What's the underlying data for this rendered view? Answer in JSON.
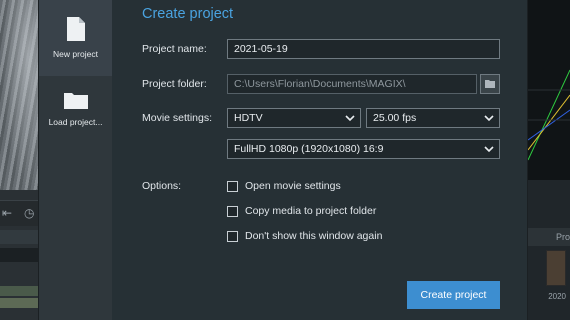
{
  "sidebar": {
    "items": [
      {
        "label": "New project",
        "icon": "document-icon",
        "active": true
      },
      {
        "label": "Load project...",
        "icon": "folder-icon",
        "active": false
      }
    ]
  },
  "dialog": {
    "title": "Create project",
    "project_name": {
      "label": "Project name:",
      "value": "2021-05-19"
    },
    "project_folder": {
      "label": "Project folder:",
      "value": "C:\\Users\\Florian\\Documents\\MAGIX\\",
      "button_icon": "folder-icon"
    },
    "movie_settings": {
      "label": "Movie settings:",
      "format": "HDTV",
      "fps": "25.00 fps",
      "resolution": "FullHD 1080p (1920x1080) 16:9"
    },
    "options": {
      "label": "Options:",
      "items": [
        {
          "label": "Open movie settings",
          "checked": false
        },
        {
          "label": "Copy media to project folder",
          "checked": false
        },
        {
          "label": "Don't show this window again",
          "checked": false
        }
      ]
    },
    "create_button": "Create project"
  },
  "background": {
    "right_tab": "Pro",
    "right_caption": "2020"
  },
  "colors": {
    "accent": "#4aa3e0",
    "button": "#3d8ed0",
    "dialog_bg": "#263035",
    "sidebar_bg": "#2f373c"
  }
}
